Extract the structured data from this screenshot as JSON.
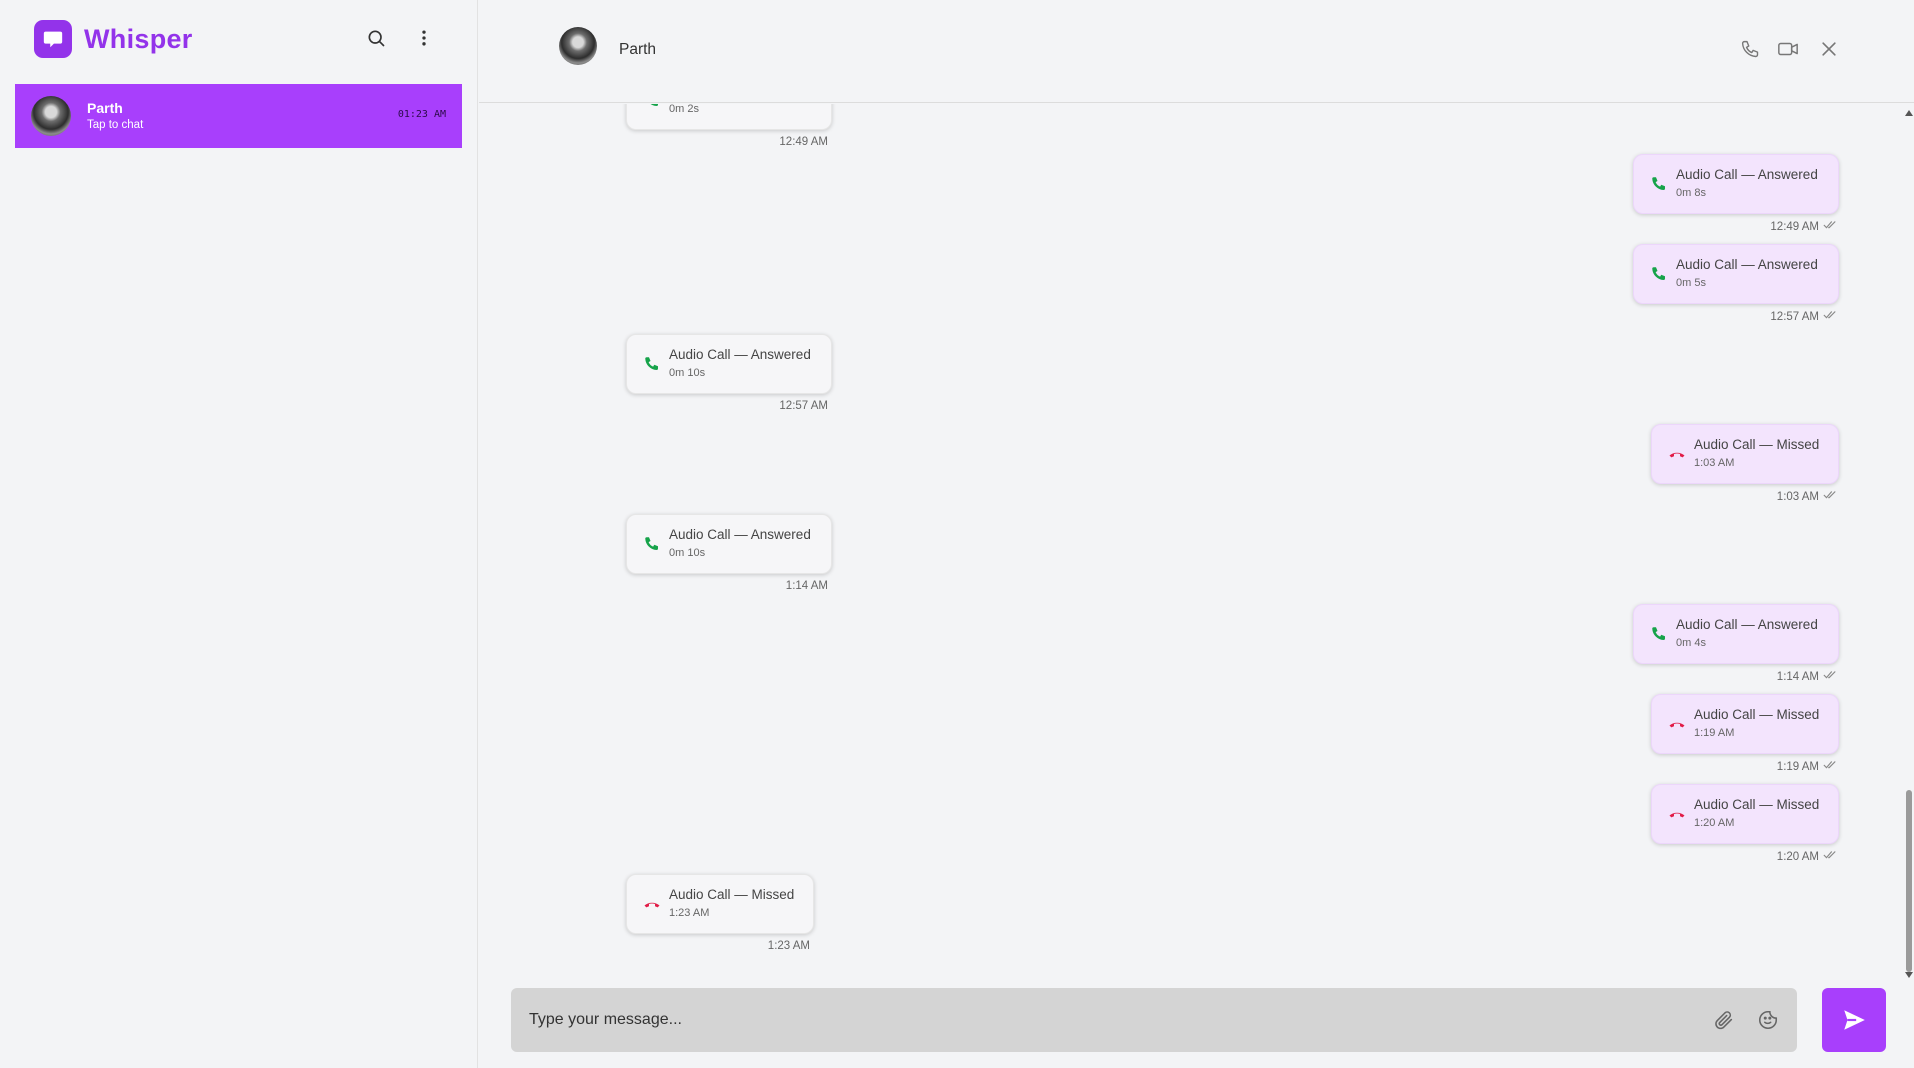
{
  "app": {
    "name": "Whisper"
  },
  "colors": {
    "accent": "#a83ffc",
    "brand": "#9333ea",
    "answered": "#16a34a",
    "missed": "#e11d48"
  },
  "sidebar": {
    "chats": [
      {
        "name": "Parth",
        "subtitle": "Tap to chat",
        "time": "01:23 AM"
      }
    ]
  },
  "header": {
    "contact_name": "Parth"
  },
  "messages": [
    {
      "direction": "in",
      "title": "",
      "detail": "0m 2s",
      "time": "12:49 AM",
      "status": "answered"
    },
    {
      "direction": "out",
      "title": "Audio Call — Answered",
      "detail": "0m 8s",
      "time": "12:49 AM",
      "status": "answered"
    },
    {
      "direction": "out",
      "title": "Audio Call — Answered",
      "detail": "0m 5s",
      "time": "12:57 AM",
      "status": "answered"
    },
    {
      "direction": "in",
      "title": "Audio Call — Answered",
      "detail": "0m 10s",
      "time": "12:57 AM",
      "status": "answered"
    },
    {
      "direction": "out",
      "title": "Audio Call — Missed",
      "detail": "1:03 AM",
      "time": "1:03 AM",
      "status": "missed"
    },
    {
      "direction": "in",
      "title": "Audio Call — Answered",
      "detail": "0m 10s",
      "time": "1:14 AM",
      "status": "answered"
    },
    {
      "direction": "out",
      "title": "Audio Call — Answered",
      "detail": "0m 4s",
      "time": "1:14 AM",
      "status": "answered"
    },
    {
      "direction": "out",
      "title": "Audio Call — Missed",
      "detail": "1:19 AM",
      "time": "1:19 AM",
      "status": "missed"
    },
    {
      "direction": "out",
      "title": "Audio Call — Missed",
      "detail": "1:20 AM",
      "time": "1:20 AM",
      "status": "missed"
    },
    {
      "direction": "in",
      "title": "Audio Call — Missed",
      "detail": "1:23 AM",
      "time": "1:23 AM",
      "status": "missed"
    }
  ],
  "composer": {
    "placeholder": "Type your message..."
  },
  "icons": {
    "logo": "chat-bubble-icon",
    "search": "search-icon",
    "more": "more-vertical-icon",
    "call": "phone-icon",
    "video": "video-camera-icon",
    "close": "close-icon",
    "attach": "paperclip-icon",
    "emoji": "sticker-icon",
    "send": "send-icon",
    "read": "double-check-icon"
  }
}
